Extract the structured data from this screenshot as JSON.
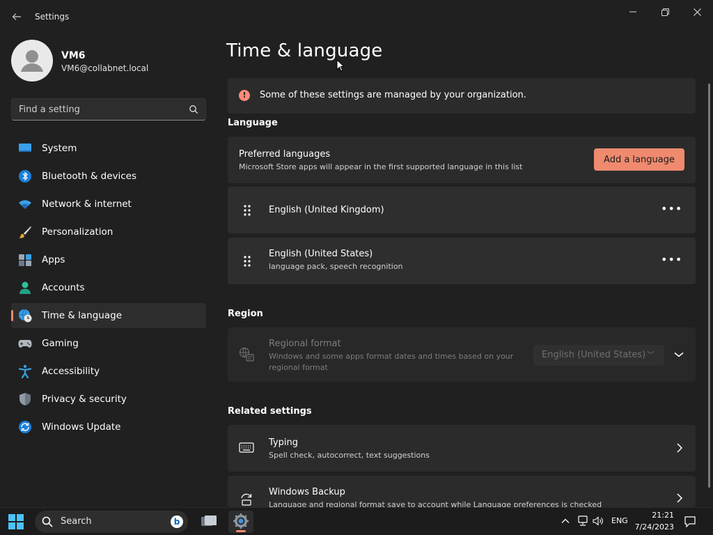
{
  "window": {
    "app_title": "Settings"
  },
  "profile": {
    "name": "VM6",
    "email": "VM6@collabnet.local"
  },
  "search": {
    "placeholder": "Find a setting"
  },
  "sidebar": {
    "items": [
      {
        "label": "System",
        "icon": "system-icon"
      },
      {
        "label": "Bluetooth & devices",
        "icon": "bluetooth-icon"
      },
      {
        "label": "Network & internet",
        "icon": "wifi-icon"
      },
      {
        "label": "Personalization",
        "icon": "brush-icon"
      },
      {
        "label": "Apps",
        "icon": "apps-icon"
      },
      {
        "label": "Accounts",
        "icon": "person-icon"
      },
      {
        "label": "Time & language",
        "icon": "globe-clock-icon",
        "active": true
      },
      {
        "label": "Gaming",
        "icon": "gamepad-icon"
      },
      {
        "label": "Accessibility",
        "icon": "accessibility-icon"
      },
      {
        "label": "Privacy & security",
        "icon": "shield-icon"
      },
      {
        "label": "Windows Update",
        "icon": "update-icon"
      }
    ]
  },
  "main": {
    "title": "Time & language",
    "org_notice": "Some of these settings are managed by your organization.",
    "language_section": "Language",
    "preferred": {
      "title": "Preferred languages",
      "subtitle": "Microsoft Store apps will appear in the first supported language in this list",
      "add_button": "Add a language"
    },
    "languages": [
      {
        "name": "English (United Kingdom)",
        "detail": ""
      },
      {
        "name": "English (United States)",
        "detail": "language pack, speech recognition"
      }
    ],
    "more_label": "•••",
    "region_section": "Region",
    "regional_format": {
      "title": "Regional format",
      "description": "Windows and some apps format dates and times based on your regional format",
      "selected": "English (United States)"
    },
    "related_section": "Related settings",
    "related": [
      {
        "title": "Typing",
        "subtitle": "Spell check, autocorrect, text suggestions"
      },
      {
        "title": "Windows Backup",
        "subtitle": "Language and regional format save to account while Language preferences is checked"
      }
    ]
  },
  "taskbar": {
    "search_label": "Search",
    "language": "ENG",
    "time": "21:21",
    "date": "7/24/2023"
  },
  "colors": {
    "accent": "#ef8a6f",
    "background": "#202020",
    "card": "#2b2b2b"
  }
}
